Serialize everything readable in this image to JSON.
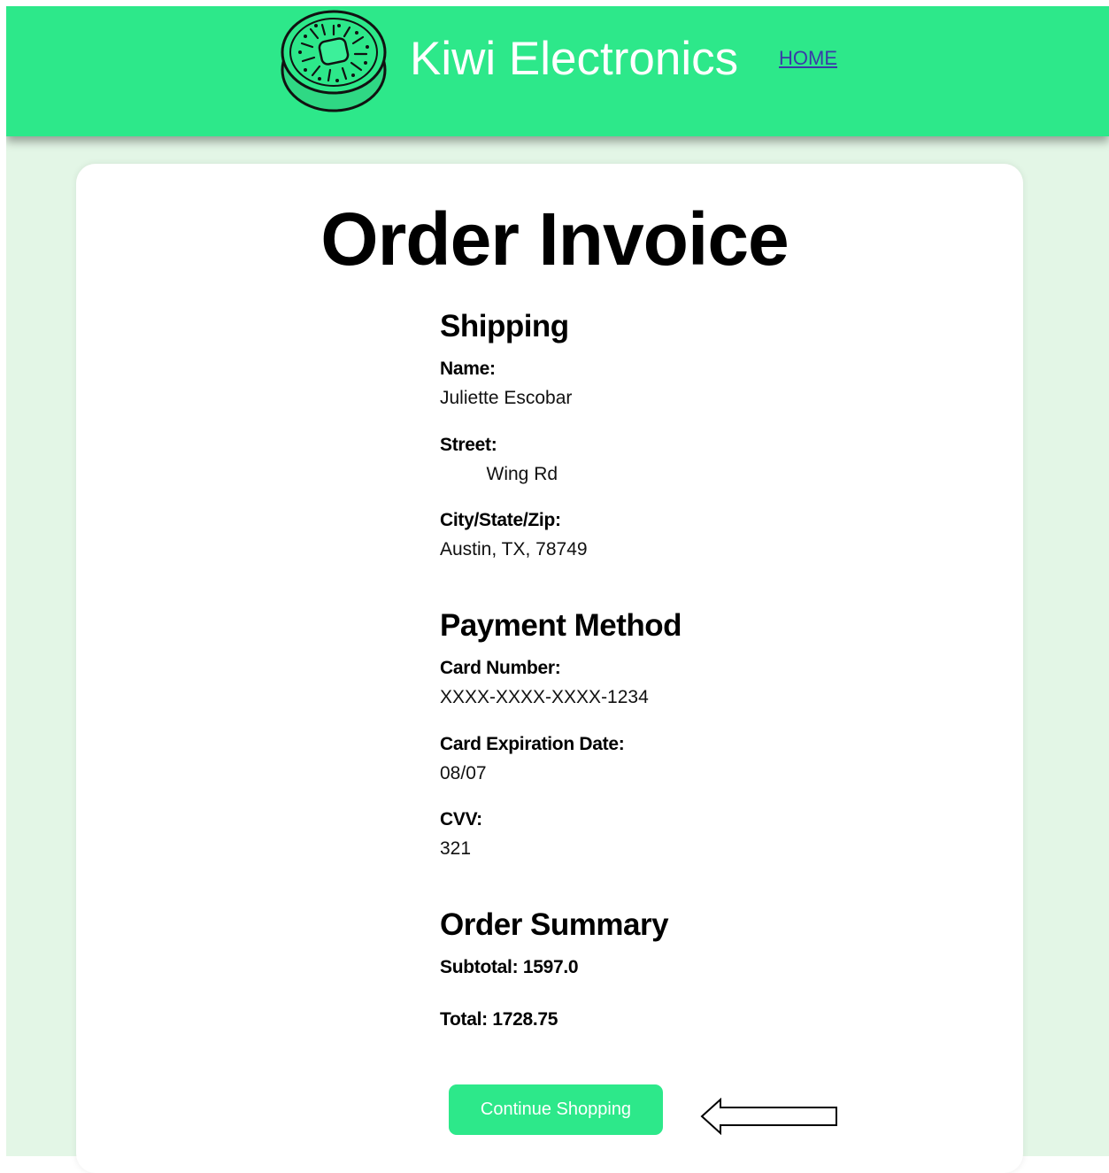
{
  "header": {
    "brand": "Kiwi Electronics",
    "home_link": "HOME",
    "background_color": "#2de88a",
    "logo_icon": "kiwi-fruit-icon"
  },
  "main": {
    "title": "Order Invoice",
    "shipping": {
      "heading": "Shipping",
      "name_label": "Name:",
      "name_value": "Juliette Escobar",
      "street_label": "Street:",
      "street_value": "         Wing Rd",
      "city_label": "City/State/Zip:",
      "city_value": "Austin, TX, 78749"
    },
    "payment": {
      "heading": "Payment Method",
      "card_number_label": "Card Number:",
      "card_number_value": "XXXX-XXXX-XXXX-1234",
      "expiration_label": "Card Expiration Date:",
      "expiration_value": "08/07",
      "cvv_label": "CVV:",
      "cvv_value": "321"
    },
    "summary": {
      "heading": "Order Summary",
      "subtotal": "Subtotal: 1597.0",
      "total": "Total: 1728.75"
    },
    "continue_button": "Continue Shopping",
    "annotation_icon": "left-arrow-icon"
  }
}
